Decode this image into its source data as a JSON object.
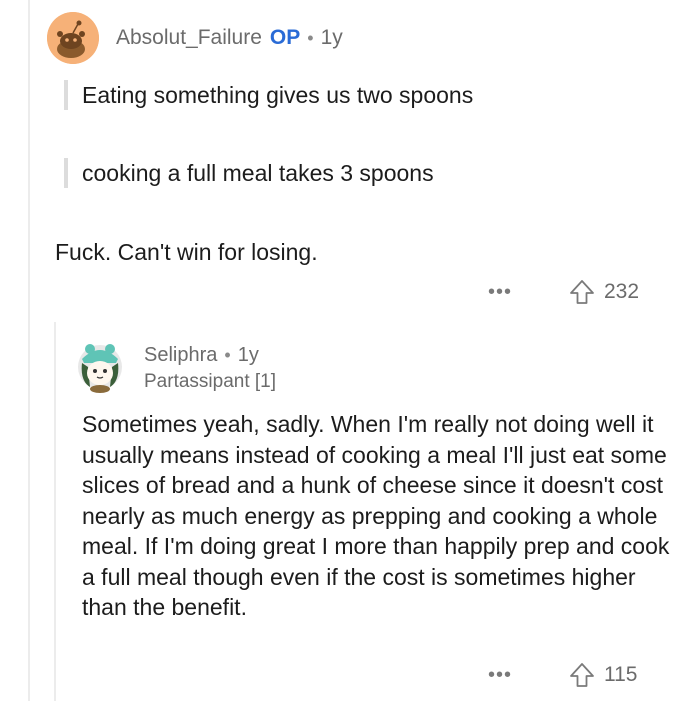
{
  "comment": {
    "username": "Absolut_Failure",
    "op_badge": "OP",
    "separator": "•",
    "age": "1y",
    "quotes": [
      "Eating something gives us two spoons",
      "cooking a full meal takes 3 spoons"
    ],
    "body": "Fuck. Can't win for losing.",
    "more_label": "•••",
    "upvotes": "232"
  },
  "reply": {
    "username": "Seliphra",
    "separator": "•",
    "age": "1y",
    "flair": "Partassipant [1]",
    "body": "Sometimes yeah, sadly. When I'm really not doing well it usually means instead of cooking a meal I'll just eat some slices of bread and a hunk of cheese since it doesn't cost nearly as much energy as prepping and cooking a whole meal. If I'm doing great I more than happily prep and cook a full meal though even if the cost is sometimes higher than the benefit.",
    "more_label": "•••",
    "upvotes": "115"
  },
  "colors": {
    "op": "#2a6bd6",
    "avatar_bg": "#f6b178",
    "meta_text": "#6b6b6b"
  },
  "icons": {
    "upvote": "upvote-arrow-icon",
    "more": "more-options-icon"
  }
}
